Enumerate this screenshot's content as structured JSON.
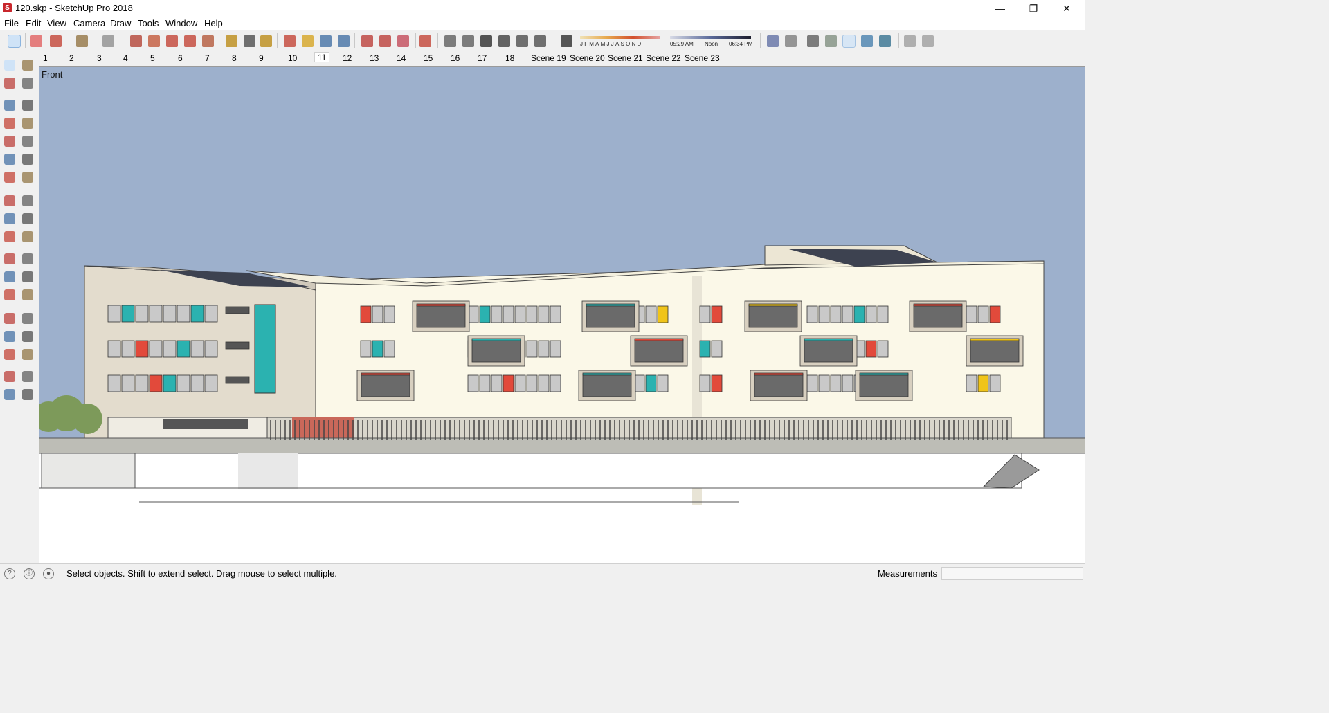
{
  "window": {
    "title": "120.skp - SketchUp Pro 2018",
    "app_icon_letter": "S",
    "minimize": "—",
    "restore": "❐",
    "close": "✕"
  },
  "menu": [
    "File",
    "Edit",
    "View",
    "Camera",
    "Draw",
    "Tools",
    "Window",
    "Help"
  ],
  "shadow": {
    "months": "JFMAMJJASOND",
    "sunrise": "05:29 AM",
    "noon": "Noon",
    "sunset": "06:34 PM"
  },
  "scenes": [
    {
      "label": "1"
    },
    {
      "label": "2"
    },
    {
      "label": "3"
    },
    {
      "label": "4"
    },
    {
      "label": "5"
    },
    {
      "label": "6"
    },
    {
      "label": "7"
    },
    {
      "label": "8"
    },
    {
      "label": "9"
    },
    {
      "label": "10"
    },
    {
      "label": "11",
      "active": true
    },
    {
      "label": "12"
    },
    {
      "label": "13"
    },
    {
      "label": "14"
    },
    {
      "label": "15"
    },
    {
      "label": "16"
    },
    {
      "label": "17"
    },
    {
      "label": "18"
    },
    {
      "label": "Scene 19"
    },
    {
      "label": "Scene 20"
    },
    {
      "label": "Scene 21"
    },
    {
      "label": "Scene 22"
    },
    {
      "label": "Scene 23"
    }
  ],
  "viewport": {
    "view_name": "Front",
    "sky_color": "#9db0cc"
  },
  "toolbar_icons": [
    "select-icon",
    "eraser-icon",
    "pencil-icon",
    "shape-icon",
    "paint-icon",
    "push-pull-icon",
    "follow-me-icon",
    "move-icon",
    "rotate-icon",
    "scale-icon",
    "tape-icon",
    "text-icon",
    "paint-bucket-icon",
    "orbit-icon",
    "pan-icon",
    "zoom-icon",
    "zoom-extents-icon",
    "warehouse-icon",
    "extension-icon",
    "share-icon",
    "ruby-icon",
    "iso-view-icon",
    "top-view-icon",
    "front-view-icon",
    "right-view-icon",
    "back-view-icon",
    "left-view-icon",
    "shadow-toggle-icon",
    "xray-icon",
    "wireframe-icon",
    "hidden-line-icon",
    "shaded-icon",
    "textured-icon",
    "monochrome-icon",
    "section-plane-icon",
    "section-display-icon",
    "section-cut-icon"
  ],
  "status": {
    "hint": "Select objects. Shift to extend select. Drag mouse to select multiple.",
    "measurements_label": "Measurements",
    "measurements_value": ""
  }
}
